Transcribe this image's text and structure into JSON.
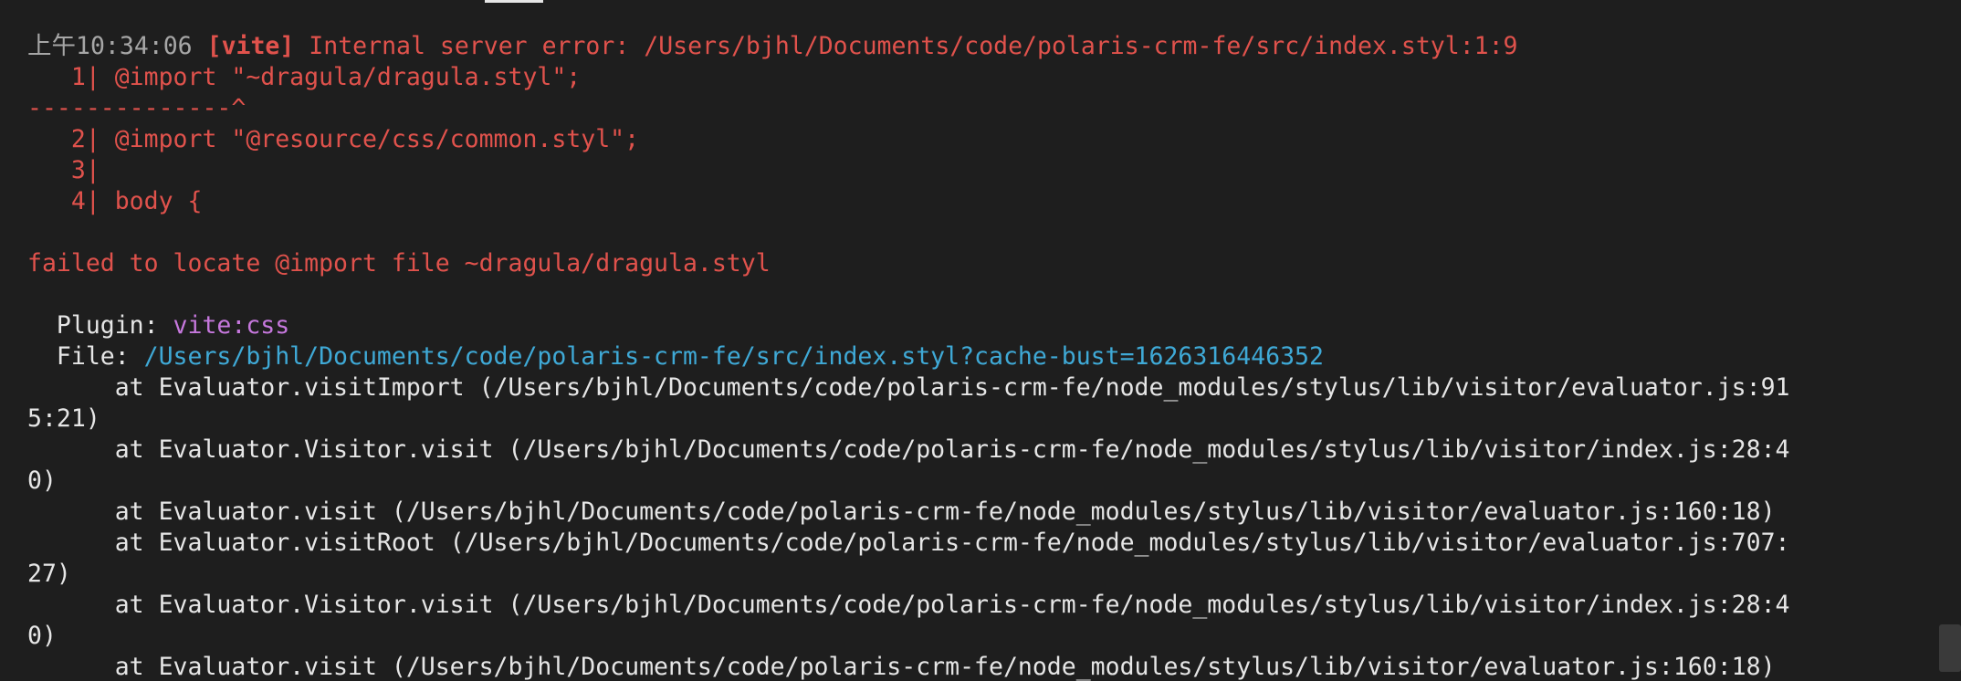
{
  "terminal": {
    "timestamp": "上午10:34:06",
    "tag": "[vite]",
    "error_message": " Internal server error: /Users/bjhl/Documents/code/polaris-crm-fe/src/index.styl:1:9",
    "code_line_1": "   1| @import \"~dragula/dragula.styl\";",
    "caret_line": "--------------^",
    "code_line_2": "   2| @import \"@resource/css/common.styl\";",
    "code_line_3": "   3|",
    "code_line_4": "   4| body {",
    "failed_message": "failed to locate @import file ~dragula/dragula.styl",
    "plugin_label": "  Plugin: ",
    "plugin_value": "vite:css",
    "file_label": "  File: ",
    "file_value": "/Users/bjhl/Documents/code/polaris-crm-fe/src/index.styl?cache-bust=1626316446352",
    "stack": [
      "      at Evaluator.visitImport (/Users/bjhl/Documents/code/polaris-crm-fe/node_modules/stylus/lib/visitor/evaluator.js:91",
      "5:21)",
      "      at Evaluator.Visitor.visit (/Users/bjhl/Documents/code/polaris-crm-fe/node_modules/stylus/lib/visitor/index.js:28:4",
      "0)",
      "      at Evaluator.visit (/Users/bjhl/Documents/code/polaris-crm-fe/node_modules/stylus/lib/visitor/evaluator.js:160:18)",
      "      at Evaluator.visitRoot (/Users/bjhl/Documents/code/polaris-crm-fe/node_modules/stylus/lib/visitor/evaluator.js:707:",
      "27)",
      "      at Evaluator.Visitor.visit (/Users/bjhl/Documents/code/polaris-crm-fe/node_modules/stylus/lib/visitor/index.js:28:4",
      "0)",
      "      at Evaluator.visit (/Users/bjhl/Documents/code/polaris-crm-fe/node_modules/stylus/lib/visitor/evaluator.js:160:18)"
    ]
  },
  "colors": {
    "background": "#1e1e1e",
    "error_red": "#e0524c",
    "plugin_magenta": "#c678dd",
    "file_cyan": "#3fa9d6",
    "timestamp_grey": "#a6a6a6",
    "text_white": "#e6e6e6"
  }
}
